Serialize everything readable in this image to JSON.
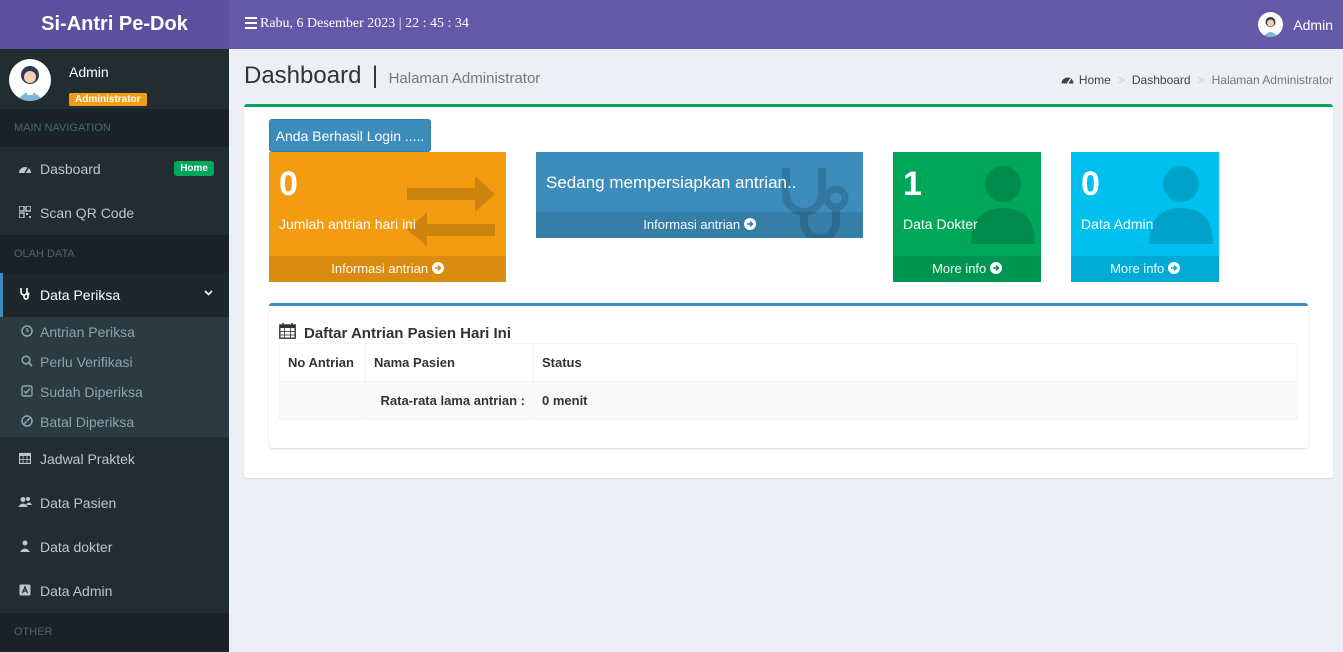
{
  "app": {
    "title": "Si-Antri Pe-Dok"
  },
  "topbar": {
    "datetime": "Rabu, 6 Desember 2023 | 22 : 45 : 34",
    "user_name": "Admin",
    "menu_icon": "hamburger-icon"
  },
  "sidebar": {
    "user": {
      "name": "Admin",
      "role": "Administrator"
    },
    "sections": {
      "main": "MAIN NAVIGATION",
      "data": "OLAH DATA",
      "other": "OTHER"
    },
    "items": [
      {
        "label": "Dasboard",
        "icon": "dashboard-icon",
        "badge": "Home"
      },
      {
        "label": "Scan QR Code",
        "icon": "qrcode-icon"
      },
      {
        "label": "Data Periksa",
        "icon": "stethoscope-icon"
      },
      {
        "label": "Jadwal Praktek",
        "icon": "calendar-icon"
      },
      {
        "label": "Data Pasien",
        "icon": "users-icon"
      },
      {
        "label": "Data dokter",
        "icon": "doctor-icon"
      },
      {
        "label": "Data Admin",
        "icon": "admin-icon"
      }
    ],
    "subitems": [
      {
        "label": "Antrian Periksa",
        "icon": "clock-icon"
      },
      {
        "label": "Perlu Verifikasi",
        "icon": "search-icon"
      },
      {
        "label": "Sudah Diperiksa",
        "icon": "check-square-icon"
      },
      {
        "label": "Batal Diperiksa",
        "icon": "ban-icon"
      }
    ]
  },
  "page": {
    "title": "Dashboard",
    "separator": "|",
    "subtitle": "Halaman Administrator",
    "breadcrumb": [
      "Home",
      "Dashboard",
      "Halaman Administrator"
    ]
  },
  "login_button": "Anda Berhasil Login .....",
  "cards": {
    "queue": {
      "value": "0",
      "label": "Jumlah antrian hari ini",
      "footer": "Informasi antrian",
      "color": "#f39c12"
    },
    "status": {
      "text": "Sedang mempersiapkan antrian..",
      "footer": "Informasi antrian",
      "color": "#3c8dbc"
    },
    "doctors": {
      "value": "1",
      "label": "Data Dokter",
      "footer": "More info",
      "color": "#00a65a"
    },
    "admins": {
      "value": "0",
      "label": "Data Admin",
      "footer": "More info",
      "color": "#00c0ef"
    }
  },
  "queue_table": {
    "title": "Daftar Antrian Pasien Hari Ini",
    "headers": [
      "No Antrian",
      "Nama Pasien",
      "Status"
    ],
    "avg_label": "Rata-rata lama antrian :",
    "avg_value": "0 menit"
  },
  "colors": {
    "header": "#6459a8",
    "logo": "#5b4f9e",
    "sidebar": "#222d32",
    "box_top": "#00a65a"
  }
}
